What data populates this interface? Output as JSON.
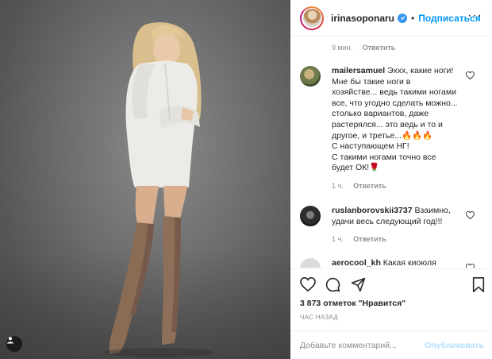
{
  "post": {
    "author": "irinasoponaru",
    "follow_label": "Подписаться",
    "top_comment_time": "9 мин.",
    "top_comment_reply": "Ответить"
  },
  "comments": [
    {
      "user": "mailersamuel",
      "lines": [
        "Эххх, какие ноги!",
        "Мне бы такие ноги в",
        "хозяйстве... ведь такими ногами",
        "все, что угодно сделать можно...",
        "столько вариантов, даже",
        "растерялся... это ведь и то и",
        "другое, и третье...🔥🔥🔥",
        "С наступающем НГ!",
        "С такими ногами точно все",
        "будет ОК!🌹"
      ],
      "time": "1 ч.",
      "reply": "Ответить"
    },
    {
      "user": "ruslanborovskii3737",
      "lines": [
        "Взаимно,",
        "удачи весь следующий год!!!"
      ],
      "time": "1 ч.",
      "reply": "Ответить"
    },
    {
      "user": "aerocool_kh",
      "lines": [
        "Какая киоюля"
      ]
    }
  ],
  "likes_text": "3 873 отметок \"Нравится\"",
  "time_ago": "ЧАС НАЗАД",
  "add_comment": {
    "placeholder": "Добавьте комментарий...",
    "publish_label": "Опубликовать"
  },
  "icons": {
    "like": "heart-icon",
    "comment": "comment-icon",
    "share": "send-icon",
    "save": "bookmark-icon",
    "more": "more-options-icon",
    "verified": "verified-badge-icon",
    "tag": "user-tag-icon"
  },
  "colors": {
    "accent": "#0095f6",
    "muted": "#8e8e8e",
    "publish_disabled": "#b2dffc"
  }
}
